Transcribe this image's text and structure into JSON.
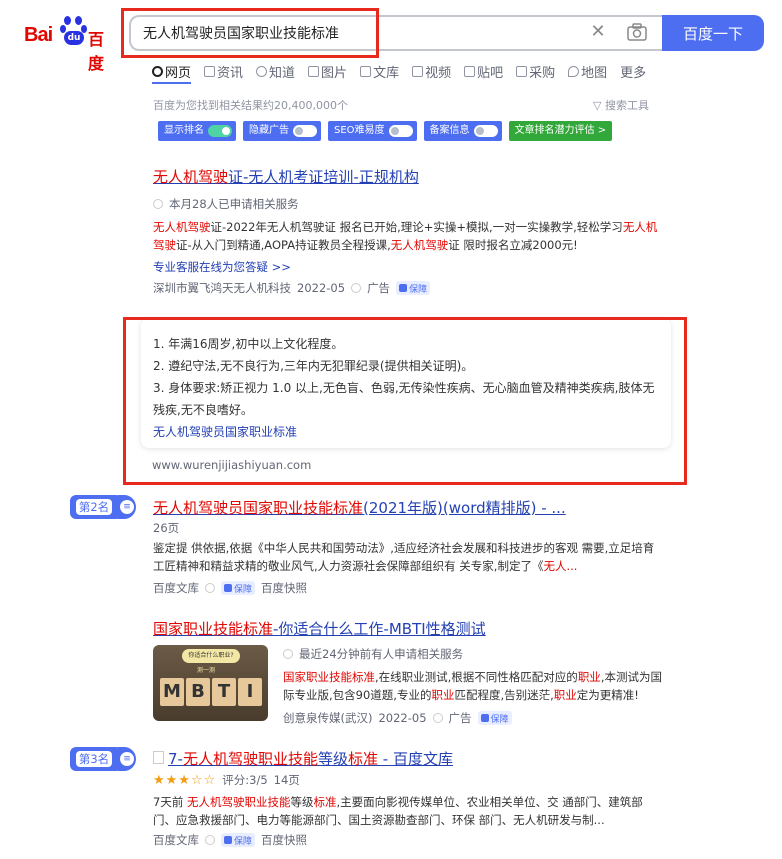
{
  "header": {
    "logo_bai": "Bai",
    "logo_du": "du",
    "logo_baidu": "百度",
    "search_query": "无人机驾驶员国家职业技能标准",
    "search_button": "百度一下"
  },
  "tabs": [
    {
      "label": "网页"
    },
    {
      "label": "资讯"
    },
    {
      "label": "知道"
    },
    {
      "label": "图片"
    },
    {
      "label": "文库"
    },
    {
      "label": "视频"
    },
    {
      "label": "贴吧"
    },
    {
      "label": "采购"
    },
    {
      "label": "地图"
    },
    {
      "label": "更多"
    }
  ],
  "result_count": "百度为您找到相关结果约20,400,000个",
  "search_tools": "搜索工具",
  "toggles": [
    {
      "label": "显示排名",
      "on": true
    },
    {
      "label": "隐藏广告",
      "on": false
    },
    {
      "label": "SEO难易度",
      "on": false
    },
    {
      "label": "备案信息",
      "on": false
    },
    {
      "label": "文章排名潜力评估 >"
    }
  ],
  "result1": {
    "title_hl": "无人机驾驶",
    "title_rest": "证-无人机考证培训-正规机构",
    "applied": "本月28人已申请相关服务",
    "snip_hl1": "无人机驾驶",
    "snip_1": "证-2022年无人机驾驶证 报名已开始,理论+实操+模拟,一对一实操教学,轻松学习",
    "snip_hl2": "无人机驾驶",
    "snip_2": "证-从入门到精通,AOPA持证教员全程授课,",
    "snip_hl3": "无人机驾驶",
    "snip_3": "证 限时报名立减2000元!",
    "service": "专业客服在线为您答疑 >>",
    "source": "深圳市翼飞鸿天无人机科技",
    "date": "2022-05",
    "ad": "广告",
    "bao": "保障"
  },
  "card": {
    "line1": "1. 年满16周岁,初中以上文化程度。",
    "line2": "2. 遵纪守法,无不良行为,三年内无犯罪纪录(提供相关证明)。",
    "line3": "3. 身体要求:矫正视力 1.0 以上,无色盲、色弱,无传染性疾病、无心脑血管及精神类疾病,肢体无残疾,无不良嗜好。",
    "link": "无人机驾驶员国家职业标准",
    "url": "www.wurenjijiashiyuan.com"
  },
  "rank2": "第2名",
  "result2": {
    "title_hl": "无人机驾驶员国家职业技能标准",
    "title_rest": "(2021年版)(word精排版) - ...",
    "pages": "26页",
    "snip": "鉴定提 供依据,依据《中华人民共和国劳动法》,适应经济社会发展和科技进步的客观 需要,立足培育工匠精神和精益求精的敬业风气,人力资源社会保障部组织有 关专家,制定了《",
    "snip_hl": "无人...",
    "source": "百度文库",
    "bao": "保障",
    "snapshot": "百度快照"
  },
  "result3": {
    "title_hl": "国家职业技能标准",
    "title_rest": "-你适合什么工作-MBTI性格测试",
    "applied": "最近24分钟前有人申请相关服务",
    "snip_hl1": "国家职业技能标准",
    "snip_1": ",在线职业测试,根据不同性格匹配对应的",
    "snip_hl2": "职业",
    "snip_2": ",本测试为国际专业版,包含90道题,专业的",
    "snip_hl3": "职业",
    "snip_3": "匹配程度,告别迷茫,",
    "snip_hl4": "职业",
    "snip_4": "定为更精准!",
    "source": "创意泉传媒(武汉)",
    "date": "2022-05",
    "ad": "广告",
    "bao": "保障",
    "img_bubble": "你适合什么职业?",
    "img_sub": "测一测",
    "img_letters": [
      "M",
      "B",
      "T",
      "I"
    ]
  },
  "rank3": "第3名",
  "result4": {
    "title_pre": "7-",
    "title_hl": "无人机驾驶职业技能",
    "title_mid": "等级",
    "title_hl2": "标准",
    "title_rest": " - 百度文库",
    "rating_value": 3,
    "rating": "评分:3/5",
    "pages": "14页",
    "snip_pre": "7天前 ",
    "snip_hl": "无人机驾驶职业技能",
    "snip_mid": "等级",
    "snip_hl2": "标准",
    "snip_rest": ",主要面向影视传媒单位、农业相关单位、交 通部门、建筑部门、应急救援部门、电力等能源部门、国土资源勘查部门、环保 部门、无人机研发与制...",
    "source": "百度文库",
    "bao": "保障",
    "snapshot": "百度快照"
  },
  "colors": {
    "accent": "#4e6ef2",
    "highlight": "#e10602",
    "link": "#2440b3",
    "annotation": "#e8291d",
    "switch_on": "#4fd2a4",
    "green": "#31a839"
  }
}
